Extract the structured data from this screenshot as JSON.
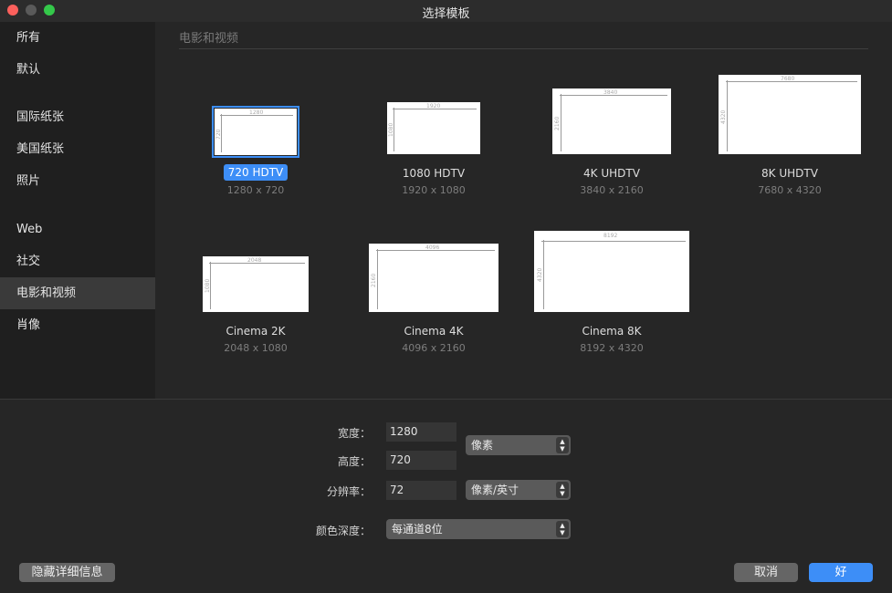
{
  "window": {
    "title": "选择模板"
  },
  "sidebar": {
    "items": [
      {
        "label": "所有"
      },
      {
        "label": "默认"
      },
      {
        "label": "国际纸张"
      },
      {
        "label": "美国纸张"
      },
      {
        "label": "照片"
      },
      {
        "label": "Web"
      },
      {
        "label": "社交"
      },
      {
        "label": "电影和视频",
        "selected": true
      },
      {
        "label": "肖像"
      }
    ]
  },
  "section": {
    "title": "电影和视频"
  },
  "templates": [
    {
      "name": "720 HDTV",
      "size": "1280 x 720",
      "w": "1280",
      "h": "720",
      "selected": true
    },
    {
      "name": "1080 HDTV",
      "size": "1920 x 1080",
      "w": "1920",
      "h": "1080"
    },
    {
      "name": "4K UHDTV",
      "size": "3840 x 2160",
      "w": "3840",
      "h": "2160"
    },
    {
      "name": "8K UHDTV",
      "size": "7680 x 4320",
      "w": "7680",
      "h": "4320"
    },
    {
      "name": "Cinema 2K",
      "size": "2048 x 1080",
      "w": "2048",
      "h": "1080"
    },
    {
      "name": "Cinema 4K",
      "size": "4096 x 2160",
      "w": "4096",
      "h": "2160"
    },
    {
      "name": "Cinema 8K",
      "size": "8192 x 4320",
      "w": "8192",
      "h": "4320"
    }
  ],
  "form": {
    "width_label": "宽度：",
    "width_value": "1280",
    "height_label": "高度：",
    "height_value": "720",
    "resolution_label": "分辨率：",
    "resolution_value": "72",
    "units_select": "像素",
    "res_units_select": "像素/英寸",
    "depth_label": "颜色深度：",
    "depth_select": "每通道8位"
  },
  "buttons": {
    "hide_details": "隐藏详细信息",
    "cancel": "取消",
    "ok": "好"
  },
  "colors": {
    "accent": "#3d8ef7",
    "background": "#262626",
    "sidebar": "#1f1f1f"
  }
}
